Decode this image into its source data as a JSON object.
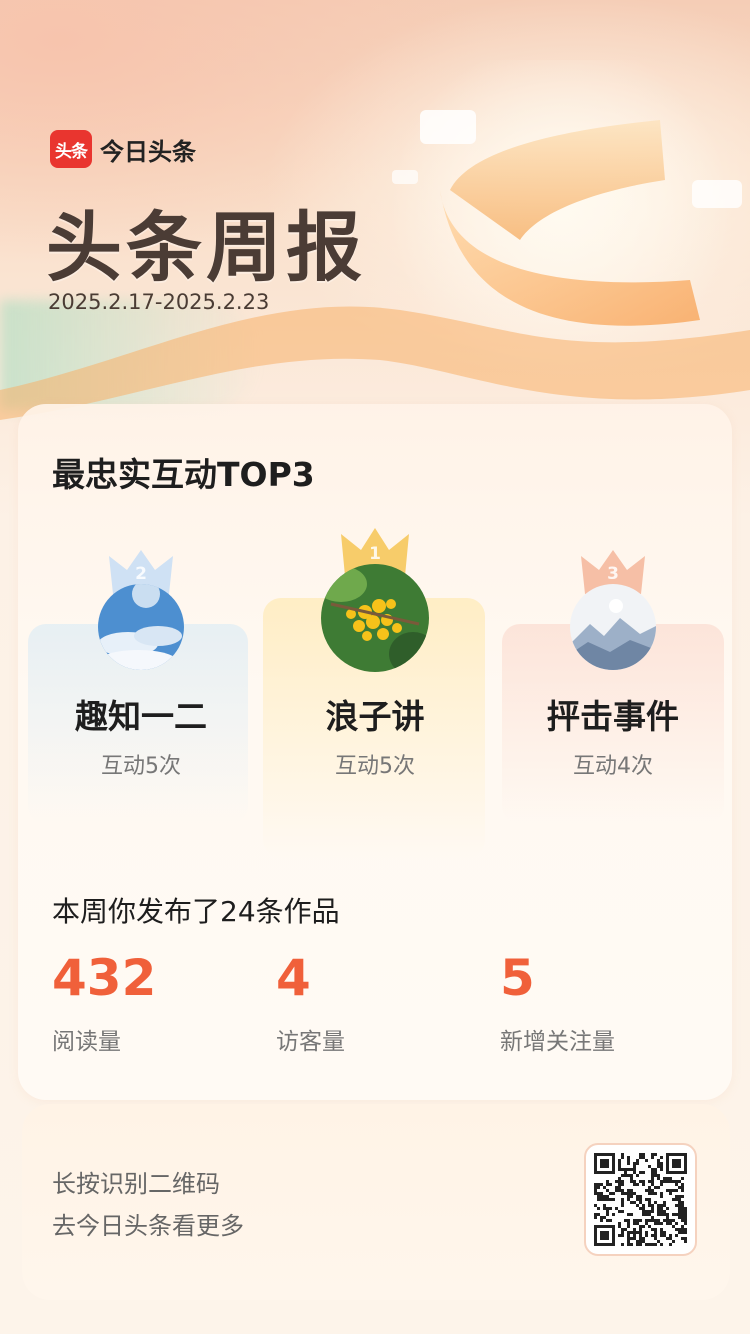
{
  "brand": {
    "badge_label": "头条",
    "app_name": "今日头条",
    "accent": "#e9352f"
  },
  "header": {
    "title": "头条周报",
    "date_range": "2025.2.17-2025.2.23"
  },
  "top_interactions": {
    "title": "最忠实互动TOP3",
    "users": [
      {
        "rank": "2",
        "name": "趣知一二",
        "count": "互动5次",
        "avatar": "sky-clouds"
      },
      {
        "rank": "1",
        "name": "浪子讲",
        "count": "互动5次",
        "avatar": "yellow-flowers"
      },
      {
        "rank": "3",
        "name": "抨击事件",
        "count": "互动4次",
        "avatar": "misty-mountains"
      }
    ]
  },
  "weekly": {
    "summary": "本周你发布了24条作品",
    "stats": [
      {
        "value": "432",
        "label": "阅读量"
      },
      {
        "value": "4",
        "label": "访客量"
      },
      {
        "value": "5",
        "label": "新增关注量"
      }
    ],
    "number_color": "#f0603a"
  },
  "footer": {
    "line1": "长按识别二维码",
    "line2": "去今日头条看更多"
  }
}
